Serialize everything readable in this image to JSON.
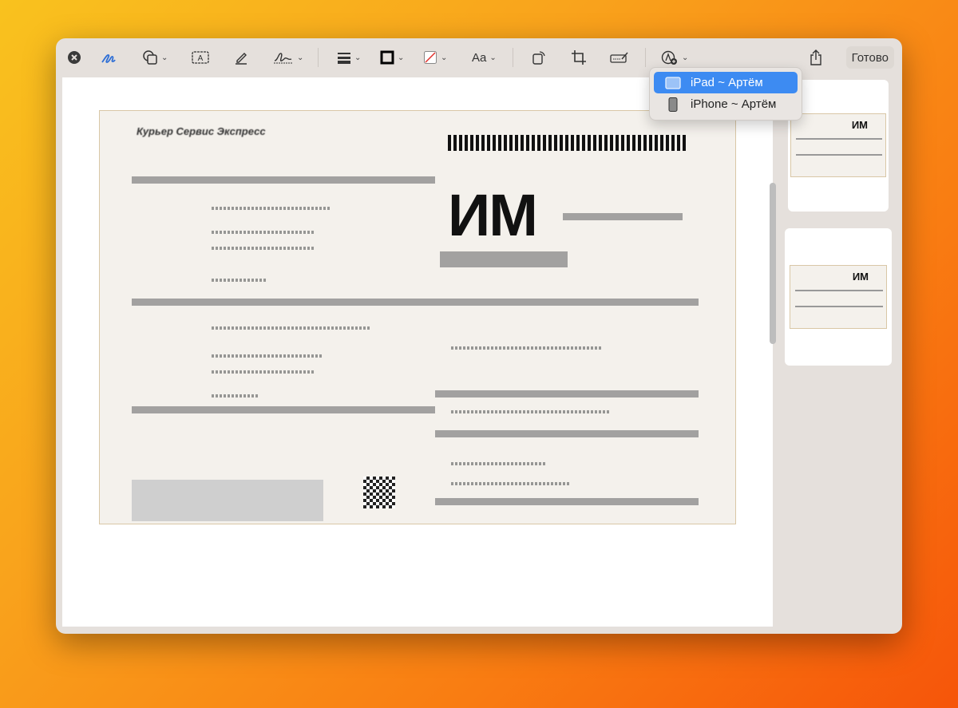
{
  "toolbar": {
    "items": [
      "close",
      "markup",
      "shapes",
      "text",
      "highlight",
      "sign",
      "line-style",
      "border-color",
      "fill-color",
      "font",
      "rotate",
      "crop",
      "form-fill",
      "annotate-from-device",
      "share"
    ],
    "font_label": "Aa",
    "done_label": "Готово"
  },
  "device_menu": {
    "items": [
      {
        "label": "iPad ~ Артём",
        "selected": true
      },
      {
        "label": "iPhone ~ Артём",
        "selected": false
      }
    ],
    "accent": "#3d8bf2"
  },
  "document": {
    "logo_text": "Курьер Сервис Экспресс",
    "big_text": "ИМ"
  },
  "thumbnails": [
    {
      "big_text": "ИМ"
    },
    {
      "big_text": "ИМ"
    }
  ]
}
